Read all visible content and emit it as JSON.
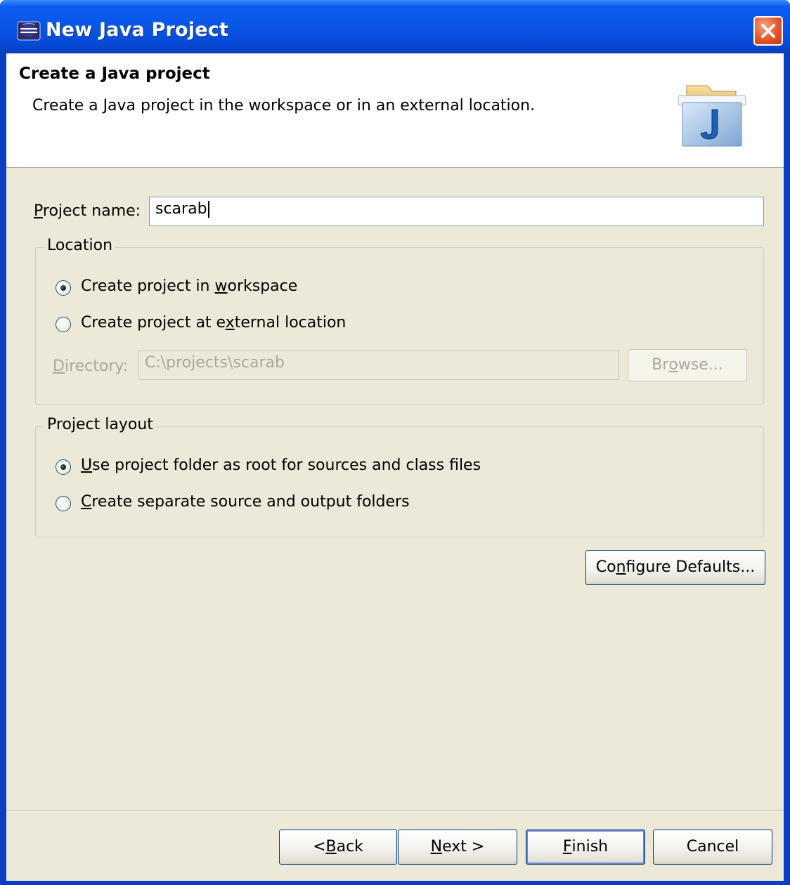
{
  "window": {
    "title": "New Java Project"
  },
  "header": {
    "title": "Create a Java project",
    "description": "Create a Java project in the workspace or in an external location."
  },
  "project_name": {
    "label": "Project name:",
    "mnemonic": "P",
    "label_rest": "roject name:",
    "value": "scarab"
  },
  "location": {
    "group_label": "Location",
    "options": [
      {
        "before": "Create project in ",
        "mnemonic": "w",
        "after": "orkspace",
        "checked": true
      },
      {
        "before": "Create project at e",
        "mnemonic": "x",
        "after": "ternal location",
        "checked": false
      }
    ],
    "directory_label_mnemonic": "D",
    "directory_label_rest": "irectory:",
    "directory_value": "C:\\projects\\scarab",
    "browse_before": "Br",
    "browse_mnemonic": "o",
    "browse_after": "wse..."
  },
  "layout": {
    "group_label": "Project layout",
    "options": [
      {
        "before": "",
        "mnemonic": "U",
        "after": "se project folder as root for sources and class files",
        "checked": true
      },
      {
        "before": "",
        "mnemonic": "C",
        "after": "reate separate source and output folders",
        "checked": false
      }
    ]
  },
  "configure": {
    "before": "Co",
    "mnemonic": "n",
    "after": "figure Defaults..."
  },
  "footer": {
    "back_before": "< ",
    "back_mnemonic": "B",
    "back_after": "ack",
    "next_mnemonic": "N",
    "next_after": "ext >",
    "finish_mnemonic": "F",
    "finish_after": "inish",
    "cancel": "Cancel"
  },
  "colors": {
    "titlebar": "#0a55e6",
    "dialog_bg": "#ece9d8",
    "disabled_text": "#aca899"
  },
  "icons": {
    "app": "eclipse-icon",
    "close": "close-icon",
    "header": "java-project-folder-icon"
  }
}
